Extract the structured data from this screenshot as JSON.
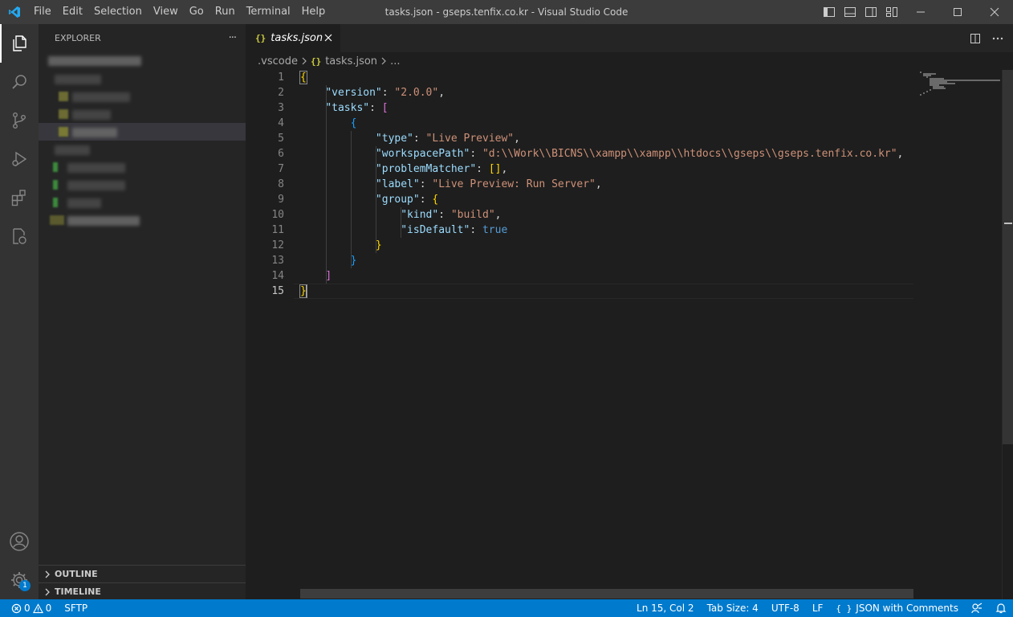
{
  "window": {
    "title": "tasks.json - gseps.tenfix.co.kr - Visual Studio Code"
  },
  "menubar": {
    "items": [
      "File",
      "Edit",
      "Selection",
      "View",
      "Go",
      "Run",
      "Terminal",
      "Help"
    ]
  },
  "sidebar": {
    "title": "EXPLORER",
    "more_label": "···",
    "sections": [
      "OUTLINE",
      "TIMELINE"
    ]
  },
  "activitybar": {
    "items": [
      "explorer-icon",
      "search-icon",
      "source-control-icon",
      "run-debug-icon",
      "extensions-icon",
      "remote-explorer-icon"
    ],
    "bottom": [
      "account-icon",
      "manage-gear-icon"
    ],
    "manage_badge": "1"
  },
  "editor": {
    "tab": {
      "icon": "{}",
      "label": "tasks.json"
    },
    "breadcrumb": {
      "folder": ".vscode",
      "icon": "{}",
      "file": "tasks.json",
      "more": "..."
    },
    "line_numbers": [
      "1",
      "2",
      "3",
      "4",
      "5",
      "6",
      "7",
      "8",
      "9",
      "10",
      "11",
      "12",
      "13",
      "14",
      "15"
    ],
    "active_line": 15,
    "code": {
      "open_brace": "{",
      "version_key": "\"version\"",
      "version_val": "\"2.0.0\"",
      "tasks_key": "\"tasks\"",
      "open_bracket": "[",
      "obj_open": "{",
      "type_key": "\"type\"",
      "type_val": "\"Live Preview\"",
      "ws_key": "\"workspacePath\"",
      "ws_val": "\"d:\\\\Work\\\\BICNS\\\\xampp\\\\xampp\\\\htdocs\\\\gseps\\\\gseps.tenfix.co.kr\"",
      "pm_key": "\"problemMatcher\"",
      "pm_val": "[]",
      "label_key": "\"label\"",
      "label_val": "\"Live Preview: Run Server\"",
      "group_key": "\"group\"",
      "group_open": "{",
      "kind_key": "\"kind\"",
      "kind_val": "\"build\"",
      "isdefault_key": "\"isDefault\"",
      "isdefault_val": "true",
      "group_close": "}",
      "obj_close": "}",
      "close_bracket": "]",
      "close_brace": "}"
    }
  },
  "statusbar": {
    "errors": "0",
    "warnings": "0",
    "sftp": "SFTP",
    "position": "Ln 15, Col 2",
    "tab_size": "Tab Size: 4",
    "encoding": "UTF-8",
    "eol": "LF",
    "language_icon": "{ }",
    "language": "JSON with Comments"
  },
  "colors": {
    "accent": "#007acc",
    "string": "#ce9178",
    "key": "#9cdcfe",
    "keyword": "#569cd6"
  }
}
